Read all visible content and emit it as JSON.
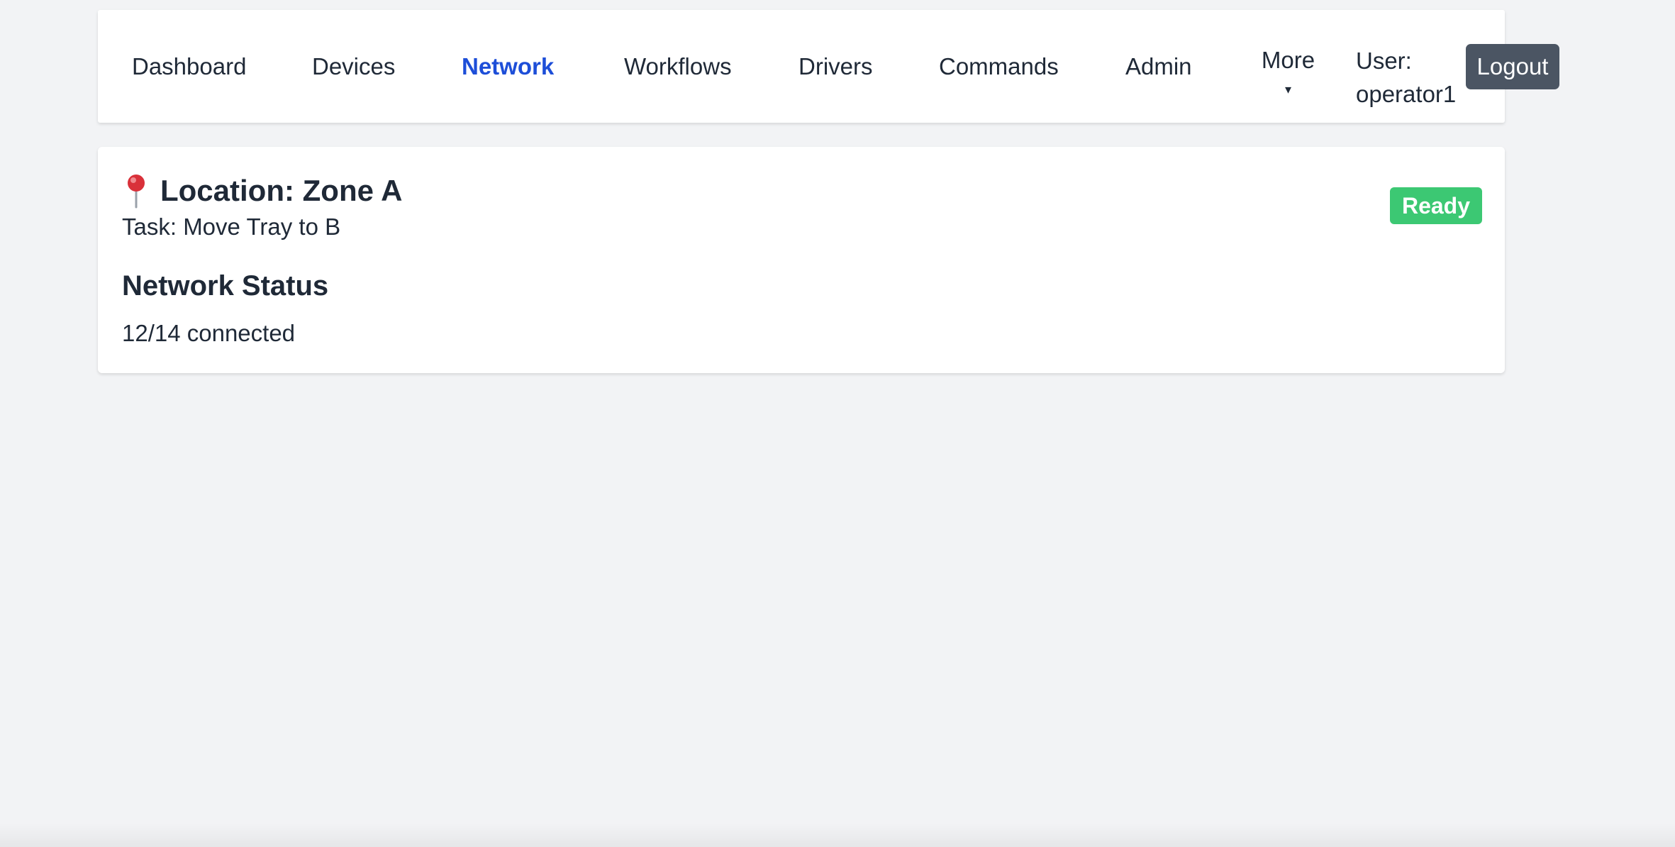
{
  "nav": {
    "items": [
      {
        "label": "Dashboard",
        "active": false
      },
      {
        "label": "Devices",
        "active": false
      },
      {
        "label": "Network",
        "active": true
      },
      {
        "label": "Workflows",
        "active": false
      },
      {
        "label": "Drivers",
        "active": false
      },
      {
        "label": "Commands",
        "active": false
      },
      {
        "label": "Admin",
        "active": false
      }
    ],
    "more_label": "More",
    "more_caret": "▾",
    "user_prefix": "User:",
    "username": "operator1",
    "logout_label": "Logout",
    "active_color": "#1d4ed8"
  },
  "card": {
    "location_icon": "pushpin-icon",
    "location_title": "Location: Zone A",
    "task": "Task: Move Tray to B",
    "status": "Ready",
    "status_color": "#3cc873",
    "section_title": "Network Status",
    "network_count": "12/14 connected"
  }
}
